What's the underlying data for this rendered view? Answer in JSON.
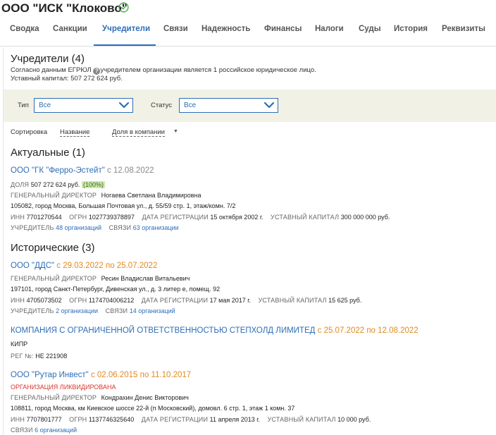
{
  "header": {
    "company_name": "ООО \"ИСК \"Клоково\"",
    "verified_icon": "check-circle-icon"
  },
  "tabs": [
    {
      "label": "Сводка"
    },
    {
      "label": "Санкции"
    },
    {
      "label": "Учредители",
      "active": true
    },
    {
      "label": "Связи"
    },
    {
      "label": "Надежность"
    },
    {
      "label": "Финансы"
    },
    {
      "label": "Налоги"
    },
    {
      "label": "Суды"
    },
    {
      "label": "История"
    },
    {
      "label": "Реквизиты"
    }
  ],
  "founders": {
    "title": "Учредители (4)",
    "desc_prefix": "Согласно данным ЕГРЮЛ",
    "desc_suffix": "учредителем организации является 1 российское юридическое лицо.",
    "capital": "Уставный капитал: 507 272 624 руб."
  },
  "filters": {
    "type_label": "Тип",
    "type_value": "Все",
    "status_label": "Статус",
    "status_value": "Все"
  },
  "sort": {
    "label": "Сортировка",
    "by_name": "Название",
    "by_share": "Доля в компании"
  },
  "current": {
    "title": "Актуальные (1)",
    "items": [
      {
        "name": "ООО \"ГК \"Ферро-Эстейт\"",
        "date": "с 12.08.2022",
        "share_label": "ДОЛЯ",
        "share_value": "507 272 624 руб.",
        "share_pct": "(100%)",
        "director_label": "ГЕНЕРАЛЬНЫЙ ДИРЕКТОР",
        "director": "Ногаева Светлана Владимировна",
        "address": "105082, город Москва, Большая Почтовая ул., д. 55/59 стр. 1, этаж/комн. 7/2",
        "inn_label": "ИНН",
        "inn": "7701270544",
        "ogrn_label": "ОГРН",
        "ogrn": "1027739378897",
        "reg_label": "ДАТА РЕГИСТРАЦИИ",
        "reg": "15 октября 2002 г.",
        "capital_label": "УСТАВНЫЙ КАПИТАЛ",
        "capital": "300 000 000 руб.",
        "founder_label": "УЧРЕДИТЕЛЬ",
        "founder_link": "48 организаций",
        "links_label": "СВЯЗИ",
        "links_link": "63 организации"
      }
    ]
  },
  "historical": {
    "title": "Исторические (3)",
    "items": [
      {
        "name": "ООО \"ДДС\"",
        "date": "с 29.03.2022 по 25.07.2022",
        "director_label": "ГЕНЕРАЛЬНЫЙ ДИРЕКТОР",
        "director": "Ресин Владислав Витальевич",
        "address": "197101, город Санкт-Петербург, Дивенская ул., д. 3 литер е, помещ. 92",
        "inn_label": "ИНН",
        "inn": "4705073502",
        "ogrn_label": "ОГРН",
        "ogrn": "1174704006212",
        "reg_label": "ДАТА РЕГИСТРАЦИИ",
        "reg": "17 мая 2017 г.",
        "capital_label": "УСТАВНЫЙ КАПИТАЛ",
        "capital": "15 625 руб.",
        "founder_label": "УЧРЕДИТЕЛЬ",
        "founder_link": "2 организации",
        "links_label": "СВЯЗИ",
        "links_link": "14 организаций"
      },
      {
        "name": "КОМПАНИЯ С ОГРАНИЧЕННОЙ ОТВЕТСТВЕННОСТЬЮ СТЕПХОЛД ЛИМИТЕД",
        "date": "с 25.07.2022 по 12.08.2022",
        "country": "КИПР",
        "reg_no_label": "РЕГ №:",
        "reg_no": "НЕ 221908"
      },
      {
        "name": "ООО \"Рутар Инвест\"",
        "date": "с 02.06.2015 по 11.10.2017",
        "status": "ОРГАНИЗАЦИЯ ЛИКВИДИРОВАНА",
        "director_label": "ГЕНЕРАЛЬНЫЙ ДИРЕКТОР",
        "director": "Кондрахин Денис Викторович",
        "address": "108811, город Москва, км Киевское шоссе 22-й (п Московский), домовл. 6 стр. 1, этаж 1 комн. 37",
        "inn_label": "ИНН",
        "inn": "7707801777",
        "ogrn_label": "ОГРН",
        "ogrn": "1137746325640",
        "reg_label": "ДАТА РЕГИСТРАЦИИ",
        "reg": "11 апреля 2013 г.",
        "capital_label": "УСТАВНЫЙ КАПИТАЛ",
        "capital": "10 000 руб.",
        "links_label": "СВЯЗИ",
        "links_link": "6 организаций"
      }
    ]
  },
  "colors": {
    "accent": "#2e6eb8",
    "date_orange": "#e08a1e",
    "liquidated_red": "#d9342b",
    "verified_green": "#4caf50",
    "filter_bg": "#f2f1e6"
  }
}
